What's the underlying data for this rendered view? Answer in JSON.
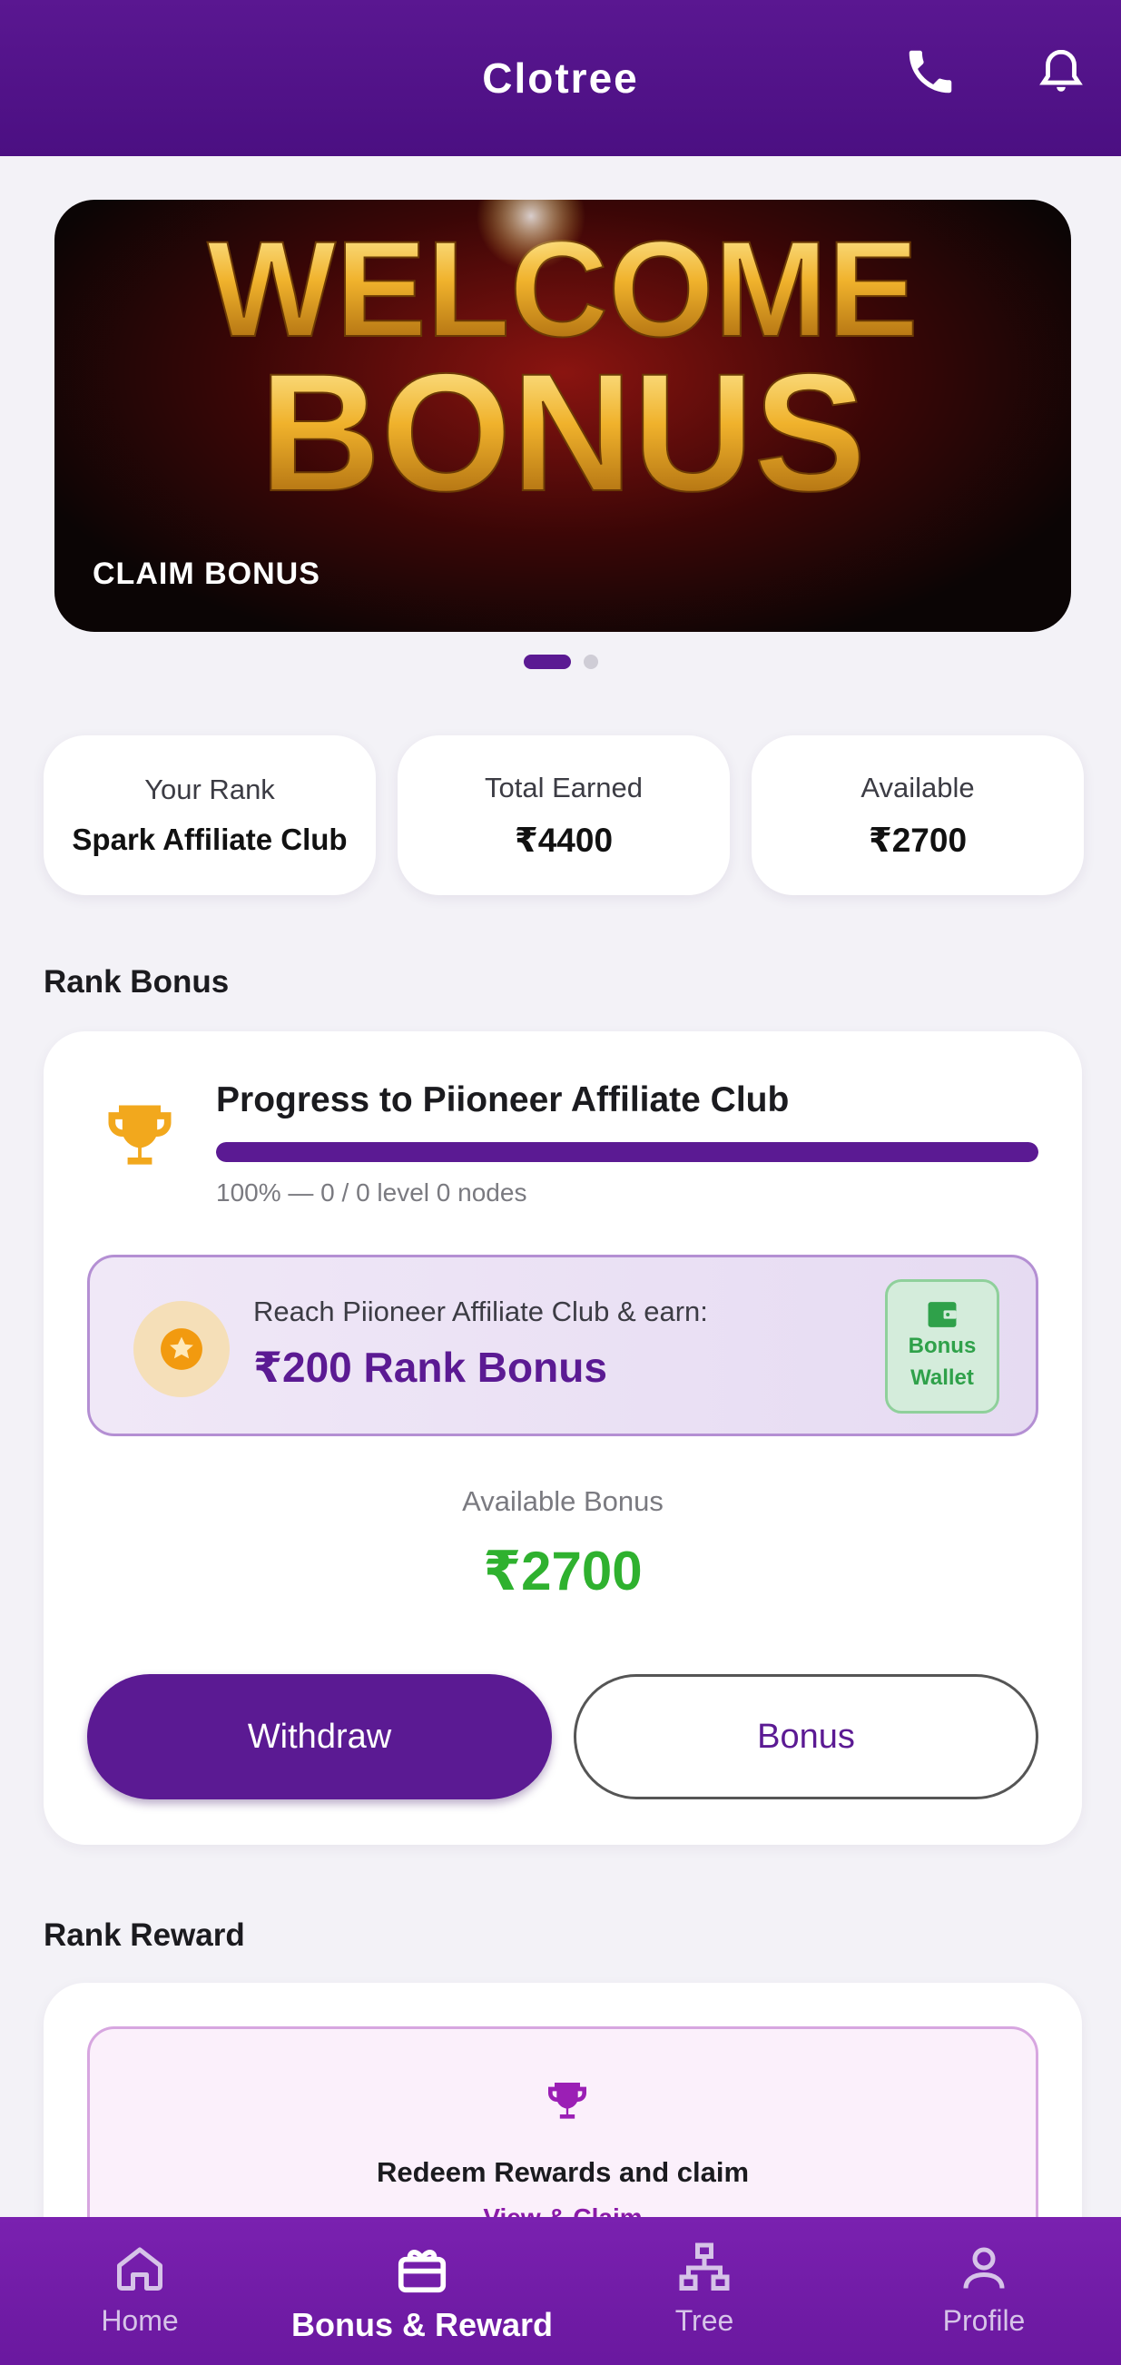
{
  "appbar": {
    "title": "Clotree",
    "phone_icon": "phone-icon",
    "bell_icon": "bell-icon"
  },
  "banner": {
    "headline_top": "WELCOME",
    "headline_bottom": "BONUS",
    "claim_label": "CLAIM BONUS",
    "page_count": 2,
    "active_page": 1
  },
  "stats": [
    {
      "label": "Your Rank",
      "value": "Spark Affiliate Club"
    },
    {
      "label": "Total Earned",
      "value": "₹4400"
    },
    {
      "label": "Available",
      "value": "₹2700"
    }
  ],
  "rank_bonus": {
    "section_title": "Rank Bonus",
    "progress_title": "Progress to Piioneer Affiliate Club",
    "progress_fraction": 1.0,
    "progress_text": "100% — 0 / 0 level 0 nodes",
    "reach_label": "Reach Piioneer Affiliate Club & earn:",
    "reach_amount": "₹200 Rank Bonus",
    "wallet_line1": "Bonus",
    "wallet_line2": "Wallet",
    "available_label": "Available Bonus",
    "available_value": "₹2700",
    "withdraw_label": "Withdraw",
    "bonus_label": "Bonus"
  },
  "rank_reward": {
    "section_title": "Rank Reward",
    "redeem_text": "Redeem Rewards and claim",
    "link_text": "View & Claim"
  },
  "bottom_nav": [
    {
      "label": "Home",
      "icon": "home-icon",
      "active": false
    },
    {
      "label": "Bonus & Reward",
      "icon": "gift-icon",
      "active": true
    },
    {
      "label": "Tree",
      "icon": "tree-icon",
      "active": false
    },
    {
      "label": "Profile",
      "icon": "profile-icon",
      "active": false
    }
  ],
  "colors": {
    "primary": "#5b1a93",
    "accent_green": "#2fb12f",
    "trophy_gold": "#f2a81d"
  }
}
